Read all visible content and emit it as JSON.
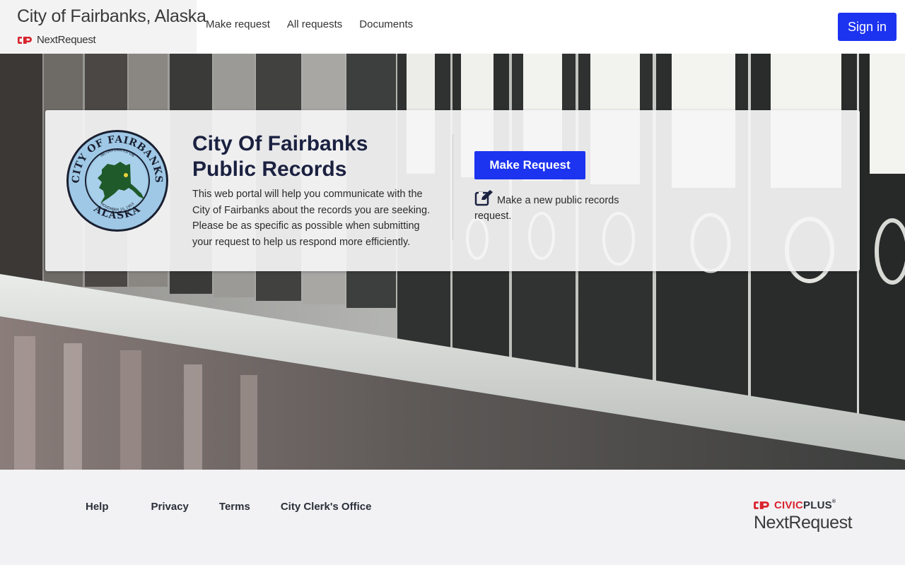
{
  "header": {
    "brand_title": "City of Fairbanks, Alaska",
    "brand_product": "NextRequest",
    "nav": [
      {
        "label": "Make request"
      },
      {
        "label": "All requests"
      },
      {
        "label": "Documents"
      }
    ],
    "sign_in": "Sign in"
  },
  "hero": {
    "title_line1": "City Of Fairbanks",
    "title_line2": "Public Records",
    "description": "This web portal will help you communicate with the City of Fairbanks about the records you are seeking. Please be as specific as possible when submitting your request to help us respond more efficiently.",
    "make_request_button": "Make Request",
    "make_request_description": "Make a new public records request.",
    "seal": {
      "top_text": "CITY OF FAIRBANKS",
      "bottom_text": "ALASKA",
      "inner_top": "INCORPORATED ON",
      "inner_date": "NOVEMBER 10, 1903"
    }
  },
  "footer": {
    "links": [
      {
        "label": "Help"
      },
      {
        "label": "Privacy"
      },
      {
        "label": "Terms"
      },
      {
        "label": "City Clerk's Office"
      }
    ],
    "civic_brand_primary": "CIVIC",
    "civic_brand_secondary": "PLUS",
    "civic_trademark": "®",
    "civic_product": "NextRequest"
  },
  "colors": {
    "primary": "#1c33f0",
    "title": "#1b2140",
    "civic_red": "#d9232d"
  }
}
